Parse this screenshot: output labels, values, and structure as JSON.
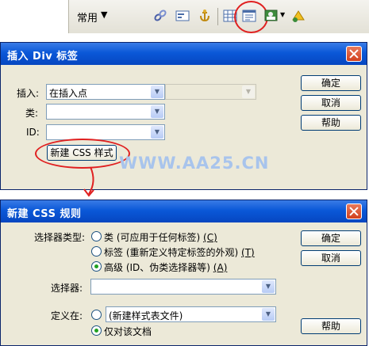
{
  "toolbar": {
    "mode_label": "常用",
    "highlight_color": "#e02020"
  },
  "insert_div_dialog": {
    "title": "插入 Div 标签",
    "insert_label": "插入:",
    "insert_value": "在插入点",
    "class_label": "类:",
    "id_label": "ID:",
    "new_css_style_button": "新建 CSS 样式",
    "ok_button": "确定",
    "cancel_button": "取消",
    "help_button": "帮助"
  },
  "watermark": "WWW.AA25.CN",
  "new_css_rule_dialog": {
    "title": "新建 CSS 规则",
    "selector_type_label": "选择器类型:",
    "selector_options": [
      {
        "label": "类 (可应用于任何标签)",
        "hotkey": "(C)",
        "checked": false
      },
      {
        "label": "标签 (重新定义特定标签的外观)",
        "hotkey": "(T)",
        "checked": false
      },
      {
        "label": "高级 (ID、伪类选择器等)",
        "hotkey": "(A)",
        "checked": true
      }
    ],
    "selector_label": "选择器:",
    "define_in_label": "定义在:",
    "define_in_new_file": "(新建样式表文件)",
    "define_in_this_doc": "仅对该文档",
    "ok_button": "确定",
    "cancel_button": "取消",
    "help_button": "帮助"
  }
}
